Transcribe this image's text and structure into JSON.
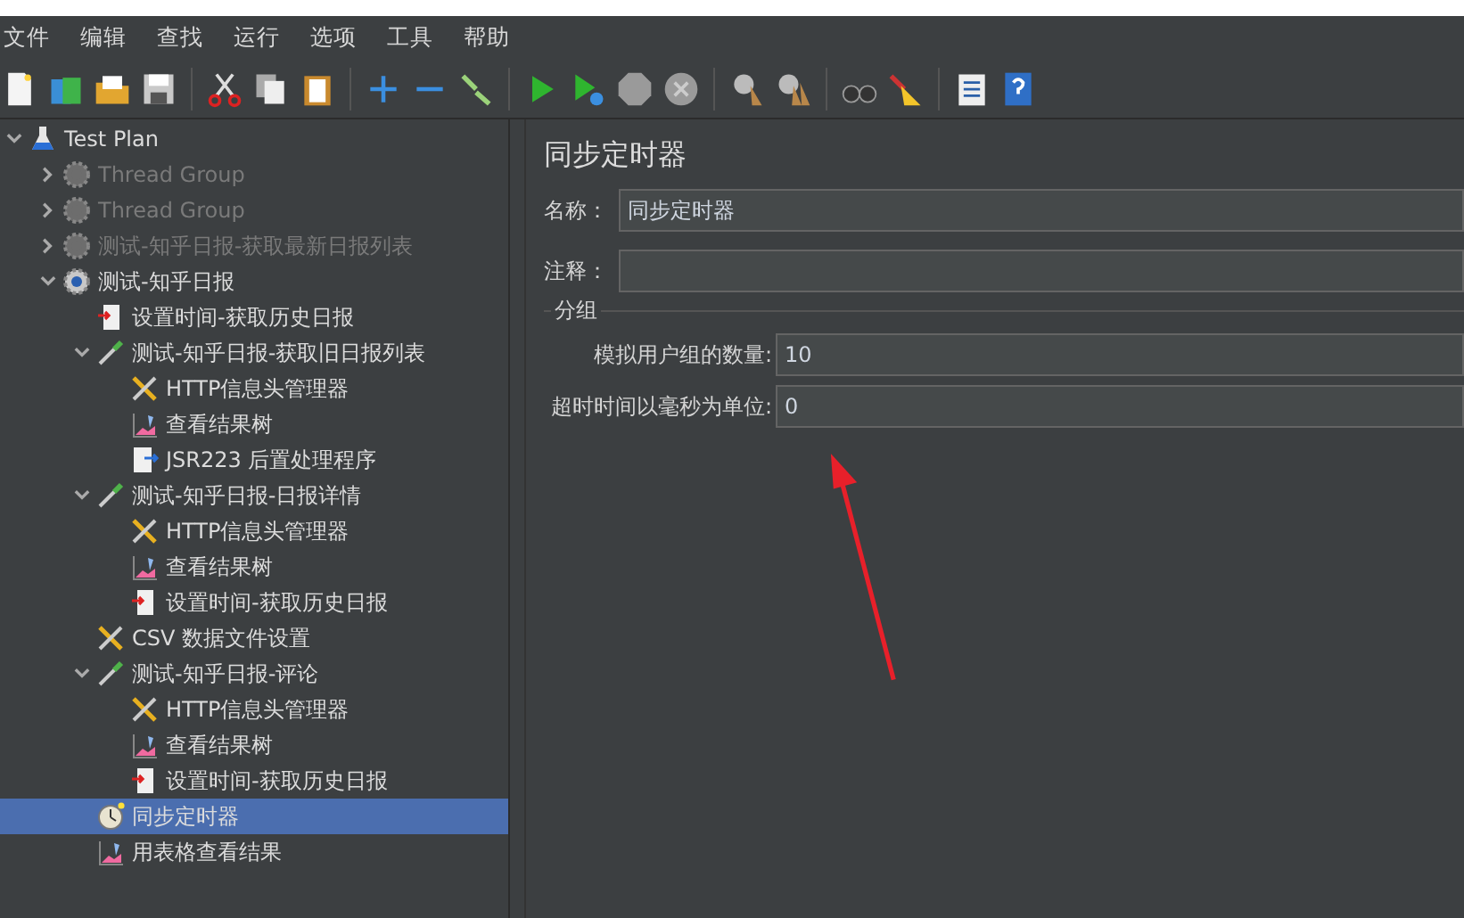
{
  "menu": [
    "文件",
    "编辑",
    "查找",
    "运行",
    "选项",
    "工具",
    "帮助"
  ],
  "tree": [
    {
      "label": "Test Plan",
      "kind": "plan",
      "expanded": true,
      "disabled": false,
      "selected": false,
      "children": [
        {
          "label": "Thread Group",
          "kind": "group",
          "expanded": false,
          "disabled": true,
          "selected": false
        },
        {
          "label": "Thread Group",
          "kind": "group",
          "expanded": false,
          "disabled": true,
          "selected": false
        },
        {
          "label": "测试-知乎日报-获取最新日报列表",
          "kind": "group",
          "expanded": false,
          "disabled": true,
          "selected": false
        },
        {
          "label": "测试-知乎日报",
          "kind": "group",
          "expanded": true,
          "disabled": false,
          "selected": false,
          "children": [
            {
              "label": "设置时间-获取历史日报",
              "kind": "pre",
              "disabled": false,
              "selected": false
            },
            {
              "label": "测试-知乎日报-获取旧日报列表",
              "kind": "sampler",
              "expanded": true,
              "disabled": false,
              "selected": false,
              "children": [
                {
                  "label": "HTTP信息头管理器",
                  "kind": "config",
                  "disabled": false,
                  "selected": false
                },
                {
                  "label": "查看结果树",
                  "kind": "listener",
                  "disabled": false,
                  "selected": false
                },
                {
                  "label": "JSR223 后置处理程序",
                  "kind": "post",
                  "disabled": false,
                  "selected": false
                }
              ]
            },
            {
              "label": "测试-知乎日报-日报详情",
              "kind": "sampler",
              "expanded": true,
              "disabled": false,
              "selected": false,
              "children": [
                {
                  "label": "HTTP信息头管理器",
                  "kind": "config",
                  "disabled": false,
                  "selected": false
                },
                {
                  "label": "查看结果树",
                  "kind": "listener",
                  "disabled": false,
                  "selected": false
                },
                {
                  "label": "设置时间-获取历史日报",
                  "kind": "pre",
                  "disabled": false,
                  "selected": false
                }
              ]
            },
            {
              "label": "CSV 数据文件设置",
              "kind": "config",
              "disabled": false,
              "selected": false
            },
            {
              "label": "测试-知乎日报-评论",
              "kind": "sampler",
              "expanded": true,
              "disabled": false,
              "selected": false,
              "children": [
                {
                  "label": "HTTP信息头管理器",
                  "kind": "config",
                  "disabled": false,
                  "selected": false
                },
                {
                  "label": "查看结果树",
                  "kind": "listener",
                  "disabled": false,
                  "selected": false
                },
                {
                  "label": "设置时间-获取历史日报",
                  "kind": "pre",
                  "disabled": false,
                  "selected": false
                }
              ]
            },
            {
              "label": "同步定时器",
              "kind": "timer",
              "disabled": false,
              "selected": true
            },
            {
              "label": "用表格查看结果",
              "kind": "listener",
              "disabled": false,
              "selected": false
            }
          ]
        }
      ]
    }
  ],
  "panel": {
    "title": "同步定时器",
    "name_field": {
      "label": "名称：",
      "value": "同步定时器"
    },
    "comment_field": {
      "label": "注释："
    },
    "group": {
      "legend": "分组",
      "fields": [
        {
          "label": "模拟用户组的数量:",
          "value": "10"
        },
        {
          "label": "超时时间以毫秒为单位:",
          "value": "0"
        }
      ]
    }
  }
}
